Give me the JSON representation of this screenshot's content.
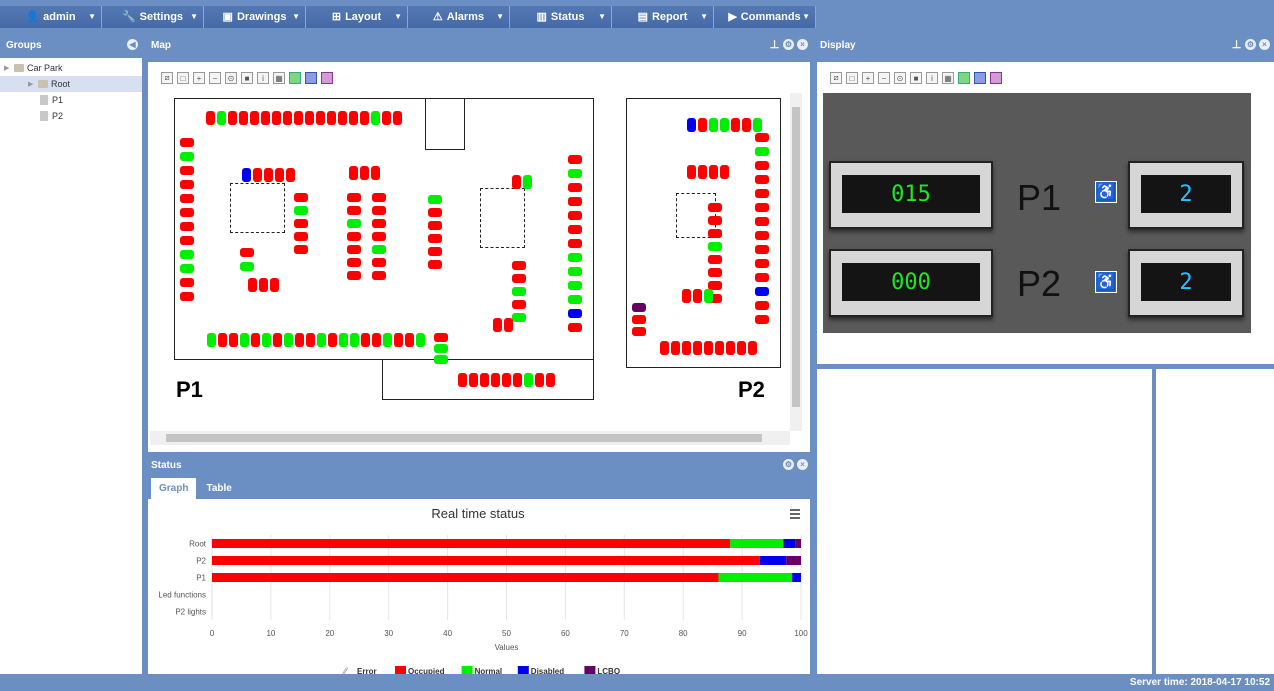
{
  "menu": {
    "items": [
      {
        "label": "admin",
        "icon": "user-icon"
      },
      {
        "label": "Settings",
        "icon": "wrench-icon"
      },
      {
        "label": "Drawings",
        "icon": "image-icon"
      },
      {
        "label": "Layout",
        "icon": "layout-icon"
      },
      {
        "label": "Alarms",
        "icon": "warning-icon"
      },
      {
        "label": "Status",
        "icon": "bar-chart-icon"
      },
      {
        "label": "Report",
        "icon": "document-icon"
      },
      {
        "label": "Commands",
        "icon": "play-icon"
      }
    ]
  },
  "groups": {
    "title": "Groups",
    "tree": [
      {
        "label": "Car Park"
      },
      {
        "label": "Root"
      },
      {
        "label": "P1"
      },
      {
        "label": "P2"
      }
    ]
  },
  "map": {
    "title": "Map",
    "label_p1": "P1",
    "label_p2": "P2"
  },
  "display": {
    "title": "Display",
    "rows": [
      {
        "label": "P1",
        "count": "015",
        "disabled": "2"
      },
      {
        "label": "P2",
        "count": "000",
        "disabled": "2"
      }
    ]
  },
  "status": {
    "title": "Status",
    "tabs": [
      {
        "label": "Graph"
      },
      {
        "label": "Table"
      }
    ]
  },
  "chart_data": {
    "type": "bar",
    "orientation": "horizontal",
    "stacked": true,
    "title": "Real time status",
    "xlabel": "Values",
    "ylabel": "",
    "xlim": [
      0,
      100
    ],
    "xticks": [
      0,
      10,
      20,
      30,
      40,
      50,
      60,
      70,
      80,
      90,
      100
    ],
    "categories": [
      "Root",
      "P2",
      "P1",
      "Led functions",
      "P2 lights"
    ],
    "series": [
      {
        "name": "Error",
        "color": "#888888",
        "values": [
          0,
          0,
          0,
          0,
          0
        ]
      },
      {
        "name": "Occupied",
        "color": "#ff0000",
        "values": [
          88,
          93,
          86,
          0,
          0
        ]
      },
      {
        "name": "Normal",
        "color": "#00ee00",
        "values": [
          9,
          0,
          12.5,
          0,
          0
        ]
      },
      {
        "name": "Disabled",
        "color": "#0000ee",
        "values": [
          2,
          4.5,
          1.5,
          0,
          0
        ]
      },
      {
        "name": "LCBO",
        "color": "#660066",
        "values": [
          1,
          2.5,
          0,
          0,
          0
        ]
      }
    ],
    "legend": "bottom-center"
  },
  "footer": {
    "server_time": "Server time: 2018-04-17 10:52"
  },
  "colors": {
    "chrome": "#6b8fc3",
    "occupied": "#ff0000",
    "normal": "#00ee00",
    "disabled": "#0000ee",
    "lcd_green": "#1ee81e",
    "lcd_cyan": "#1ec8ff"
  }
}
